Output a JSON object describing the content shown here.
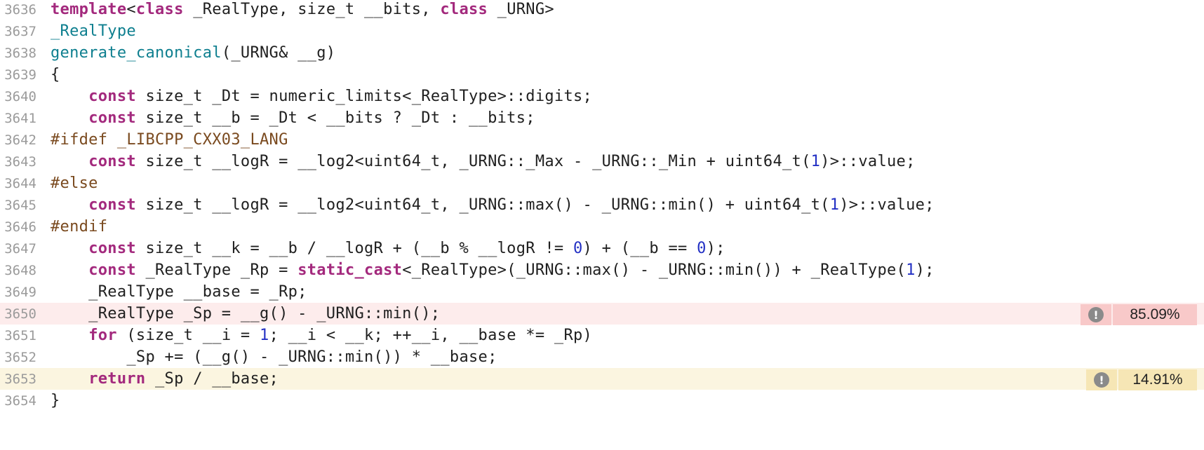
{
  "lines": [
    {
      "number": "3636",
      "tokens": [
        {
          "t": "template",
          "c": "kw"
        },
        {
          "t": "<"
        },
        {
          "t": "class",
          "c": "kw"
        },
        {
          "t": " _RealType, size_t __bits, "
        },
        {
          "t": "class",
          "c": "kw"
        },
        {
          "t": " _URNG>"
        }
      ]
    },
    {
      "number": "3637",
      "tokens": [
        {
          "t": "_RealType",
          "c": "ty"
        }
      ]
    },
    {
      "number": "3638",
      "tokens": [
        {
          "t": "generate_canonical",
          "c": "ty"
        },
        {
          "t": "(_URNG& __g)"
        }
      ]
    },
    {
      "number": "3639",
      "tokens": [
        {
          "t": "{"
        }
      ]
    },
    {
      "number": "3640",
      "tokens": [
        {
          "t": "    "
        },
        {
          "t": "const",
          "c": "kw"
        },
        {
          "t": " size_t _Dt = numeric_limits<_RealType>::digits;"
        }
      ]
    },
    {
      "number": "3641",
      "tokens": [
        {
          "t": "    "
        },
        {
          "t": "const",
          "c": "kw"
        },
        {
          "t": " size_t __b = _Dt < __bits ? _Dt : __bits;"
        }
      ]
    },
    {
      "number": "3642",
      "tokens": [
        {
          "t": "#ifdef _LIBCPP_CXX03_LANG",
          "c": "pp"
        }
      ]
    },
    {
      "number": "3643",
      "tokens": [
        {
          "t": "    "
        },
        {
          "t": "const",
          "c": "kw"
        },
        {
          "t": " size_t __logR = __log2<uint64_t, _URNG::_Max - _URNG::_Min + uint64_t("
        },
        {
          "t": "1",
          "c": "num"
        },
        {
          "t": ")>::value;"
        }
      ]
    },
    {
      "number": "3644",
      "tokens": [
        {
          "t": "#else",
          "c": "pp"
        }
      ]
    },
    {
      "number": "3645",
      "tokens": [
        {
          "t": "    "
        },
        {
          "t": "const",
          "c": "kw"
        },
        {
          "t": " size_t __logR = __log2<uint64_t, _URNG::max() - _URNG::min() + uint64_t("
        },
        {
          "t": "1",
          "c": "num"
        },
        {
          "t": ")>::value;"
        }
      ]
    },
    {
      "number": "3646",
      "tokens": [
        {
          "t": "#endif",
          "c": "pp"
        }
      ]
    },
    {
      "number": "3647",
      "tokens": [
        {
          "t": "    "
        },
        {
          "t": "const",
          "c": "kw"
        },
        {
          "t": " size_t __k = __b / __logR + (__b % __logR != "
        },
        {
          "t": "0",
          "c": "num"
        },
        {
          "t": ") + (__b == "
        },
        {
          "t": "0",
          "c": "num"
        },
        {
          "t": ");"
        }
      ]
    },
    {
      "number": "3648",
      "tokens": [
        {
          "t": "    "
        },
        {
          "t": "const",
          "c": "kw"
        },
        {
          "t": " _RealType _Rp = "
        },
        {
          "t": "static_cast",
          "c": "kw"
        },
        {
          "t": "<_RealType>(_URNG::max() - _URNG::min()) + _RealType("
        },
        {
          "t": "1",
          "c": "num"
        },
        {
          "t": ");"
        }
      ]
    },
    {
      "number": "3649",
      "tokens": [
        {
          "t": "    _RealType __base = _Rp;"
        }
      ]
    },
    {
      "number": "3650",
      "highlight": "red",
      "tokens": [
        {
          "t": "    _RealType _Sp = __g() - _URNG::min();"
        }
      ]
    },
    {
      "number": "3651",
      "tokens": [
        {
          "t": "    "
        },
        {
          "t": "for",
          "c": "kw"
        },
        {
          "t": " (size_t __i = "
        },
        {
          "t": "1",
          "c": "num"
        },
        {
          "t": "; __i < __k; ++__i, __base *= _Rp)"
        }
      ]
    },
    {
      "number": "3652",
      "tokens": [
        {
          "t": "        _Sp += (__g() - _URNG::min()) * __base;"
        }
      ]
    },
    {
      "number": "3653",
      "highlight": "yellow",
      "tokens": [
        {
          "t": "    "
        },
        {
          "t": "return",
          "c": "kw"
        },
        {
          "t": " _Sp / __base;"
        }
      ]
    },
    {
      "number": "3654",
      "tokens": [
        {
          "t": "}"
        }
      ]
    }
  ],
  "annotations": {
    "line_3650": {
      "percent": "85.09%",
      "icon": "warning-icon",
      "color": "#f8c9c9"
    },
    "line_3653": {
      "percent": "14.91%",
      "icon": "warning-icon",
      "color": "#f6e6b5"
    }
  },
  "warning_glyph": "!"
}
